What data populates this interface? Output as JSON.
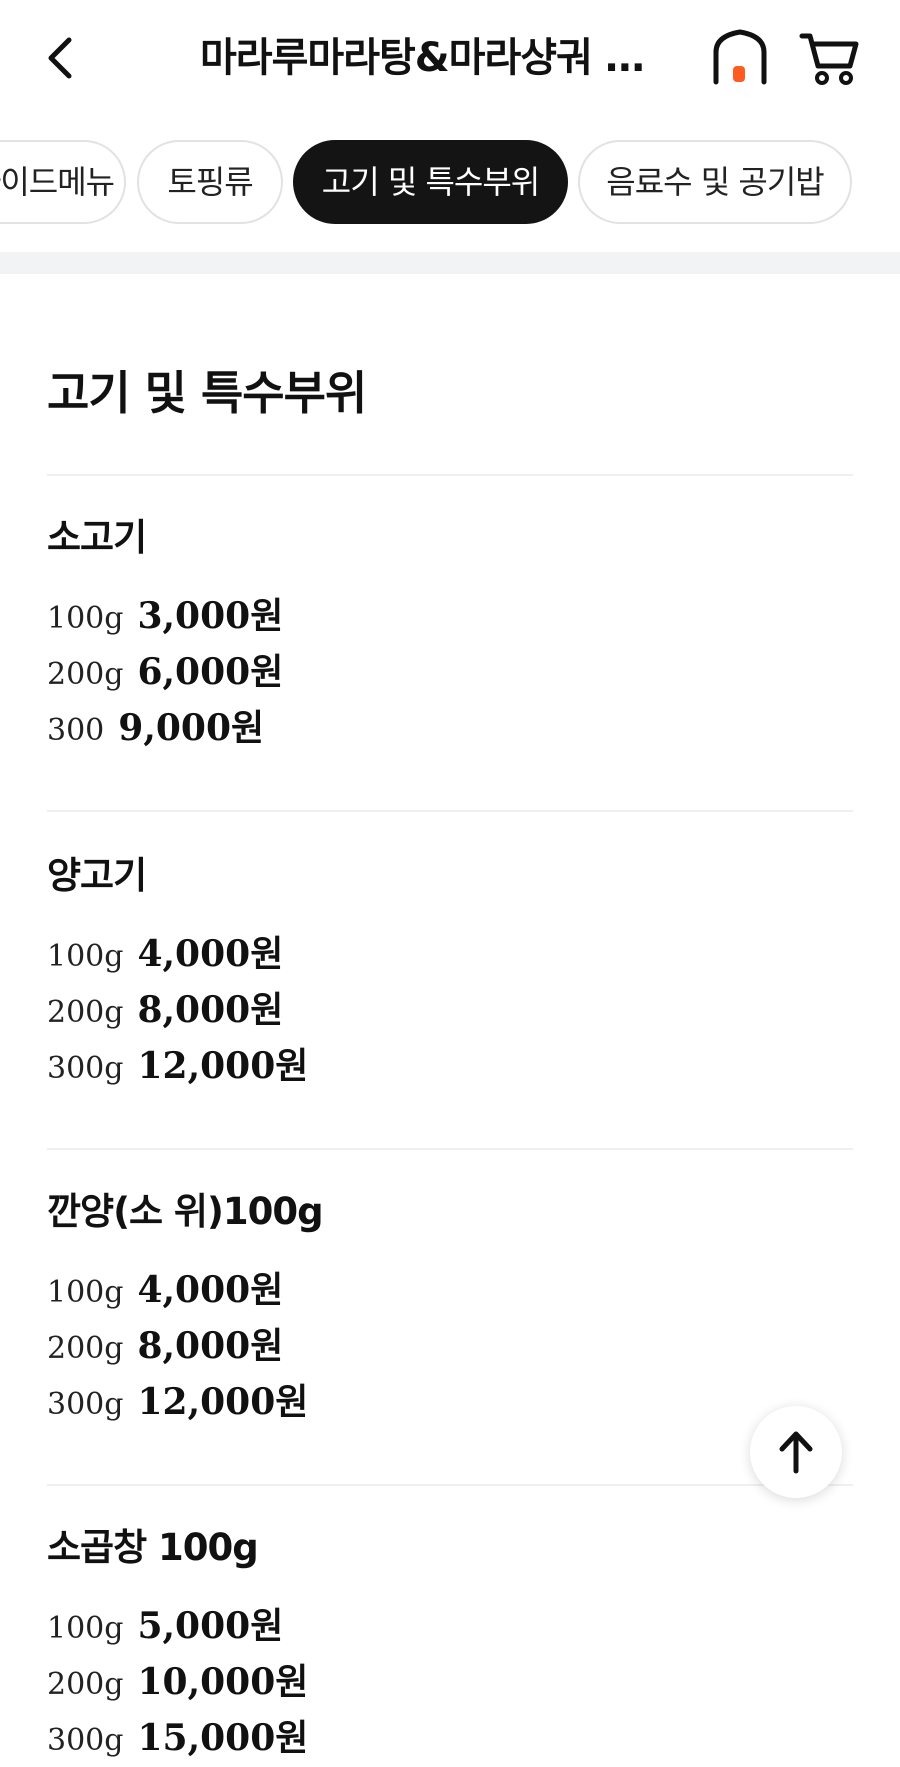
{
  "header": {
    "title": "마라루마라탕&마라샹궈 칠성점",
    "back_icon": "chevron-left-icon",
    "home_icon": "home-icon",
    "cart_icon": "cart-icon",
    "home_accent_color": "#ff5a1f"
  },
  "tabs": [
    {
      "label": "사이드메뉴",
      "active": false
    },
    {
      "label": "토핑류",
      "active": false
    },
    {
      "label": "고기 및 특수부위",
      "active": true
    },
    {
      "label": "음료수 및 공기밥",
      "active": false
    }
  ],
  "section": {
    "title": "고기 및 특수부위"
  },
  "items": [
    {
      "name": "소고기",
      "prices": [
        {
          "size": "100g",
          "price": "3,000원"
        },
        {
          "size": "200g",
          "price": "6,000원"
        },
        {
          "size": "300",
          "price": "9,000원"
        }
      ]
    },
    {
      "name": "양고기",
      "prices": [
        {
          "size": "100g",
          "price": "4,000원"
        },
        {
          "size": "200g",
          "price": "8,000원"
        },
        {
          "size": "300g",
          "price": "12,000원"
        }
      ]
    },
    {
      "name": "깐양(소 위)100g",
      "prices": [
        {
          "size": "100g",
          "price": "4,000원"
        },
        {
          "size": "200g",
          "price": "8,000원"
        },
        {
          "size": "300g",
          "price": "12,000원"
        }
      ]
    },
    {
      "name": "소곱창 100g",
      "prices": [
        {
          "size": "100g",
          "price": "5,000원"
        },
        {
          "size": "200g",
          "price": "10,000원"
        },
        {
          "size": "300g",
          "price": "15,000원"
        }
      ]
    }
  ],
  "scroll_top_icon": "arrow-up-icon"
}
